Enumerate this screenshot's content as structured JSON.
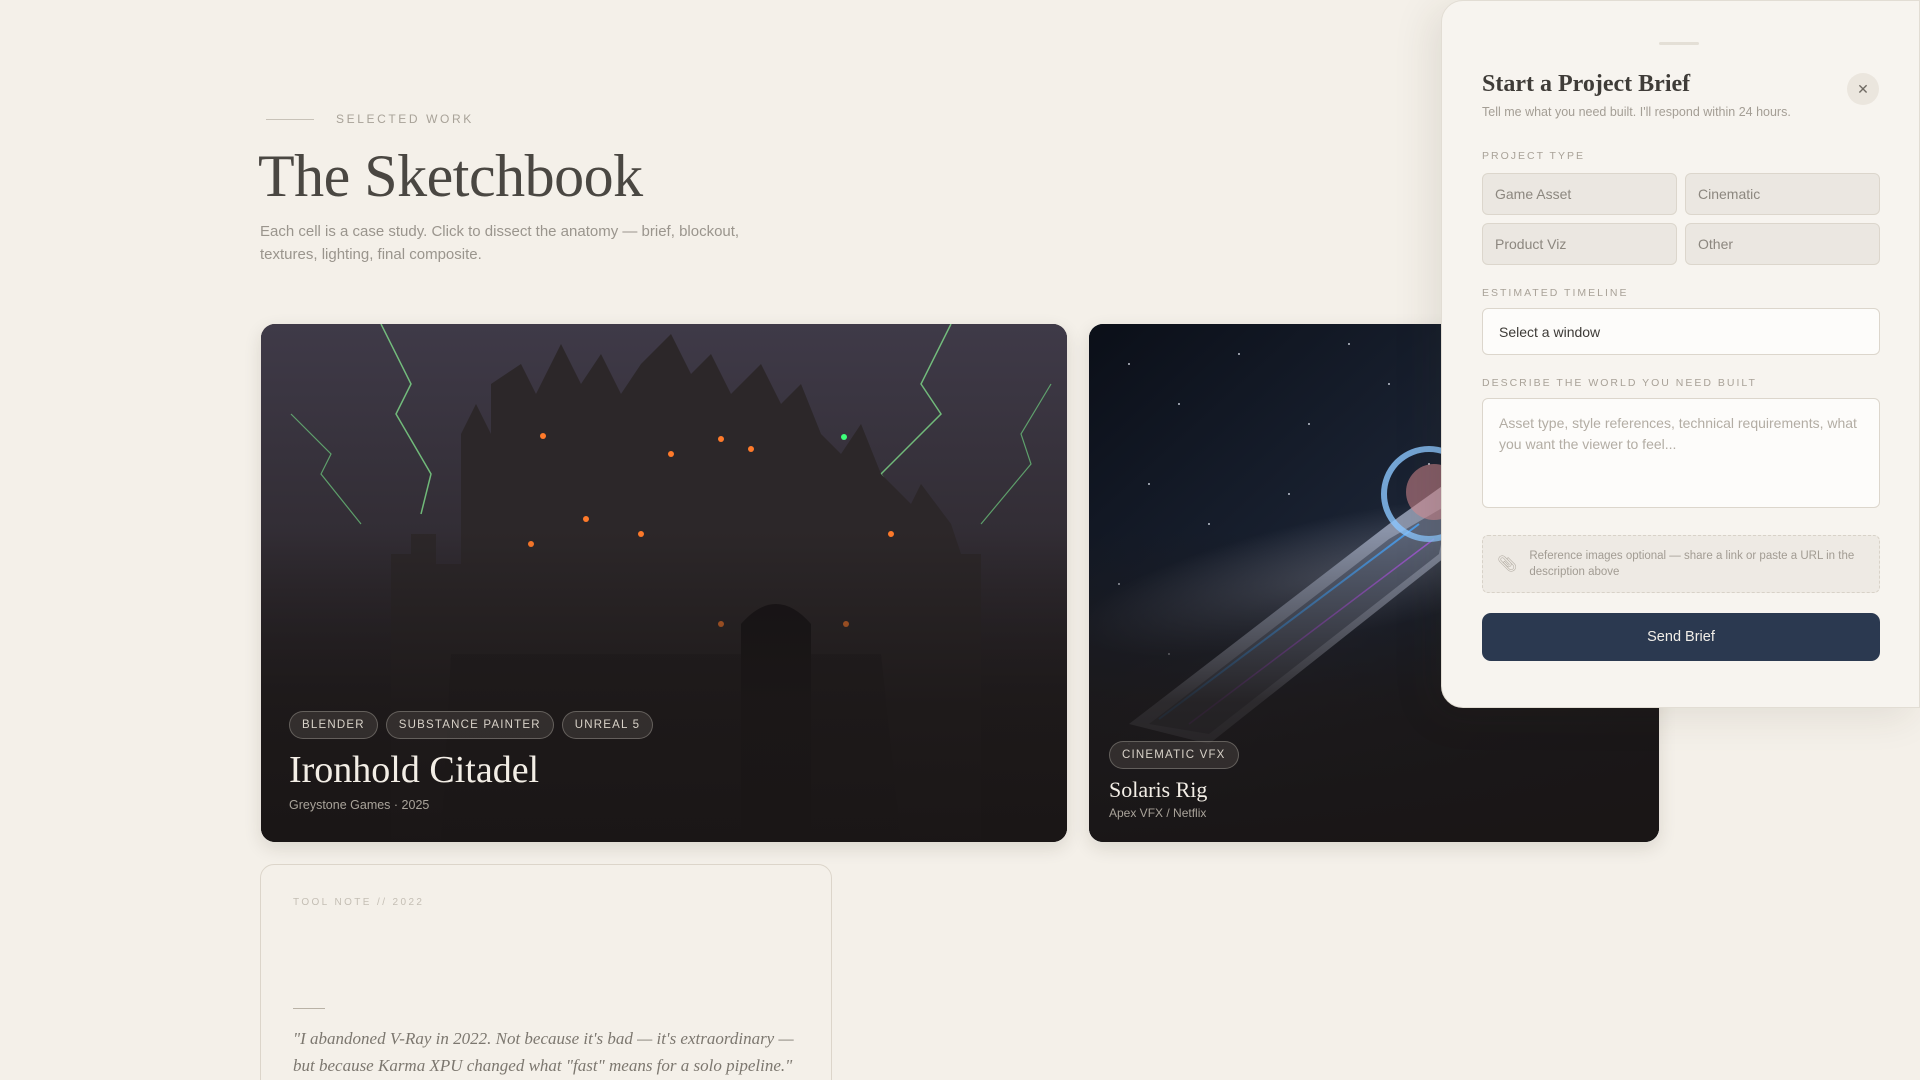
{
  "header": {
    "eyebrow": "SELECTED WORK",
    "title": "The Sketchbook",
    "subtitle": "Each cell is a case study. Click to dissect the anatomy — brief, blockout, textures, lighting, final composite."
  },
  "cards": [
    {
      "title": "Ironhold Citadel",
      "meta": "Greystone Games · 2025",
      "tags": [
        "BLENDER",
        "SUBSTANCE PAINTER",
        "UNREAL 5"
      ]
    },
    {
      "title": "Solaris Rig",
      "meta": "Apex VFX / Netflix",
      "tags": [
        "CINEMATIC VFX"
      ]
    }
  ],
  "note": {
    "label": "TOOL NOTE // 2022",
    "quote": "\"I abandoned V-Ray in 2022. Not because it's bad — it's extraordinary — but because Karma XPU changed what \"fast\" means for a solo pipeline.\""
  },
  "drawer": {
    "title": "Start a Project Brief",
    "subtitle": "Tell me what you need built. I'll respond within 24 hours.",
    "close_icon": "close-icon",
    "project_type_label": "PROJECT TYPE",
    "project_types": [
      "Game Asset",
      "Cinematic",
      "Product Viz",
      "Other"
    ],
    "timeline_label": "ESTIMATED TIMELINE",
    "timeline_value": "Select a window",
    "describe_label": "DESCRIBE THE WORLD YOU NEED BUILT",
    "describe_placeholder": "Asset type, style references, technical requirements, what you want the viewer to feel...",
    "reference_note": "Reference images optional — share a link or paste a URL in the description above",
    "reference_icon": "paperclip-icon",
    "send_label": "Send Brief",
    "accent_color": "#2b3950"
  }
}
